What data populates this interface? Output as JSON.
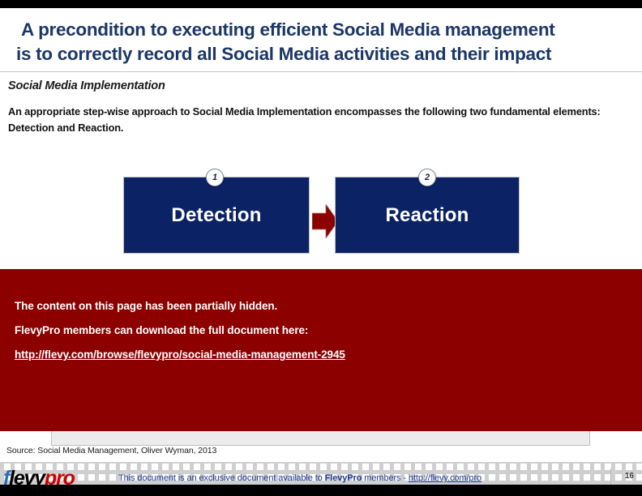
{
  "slide": {
    "title_line_1": "A precondition to executing efficient Social Media management",
    "title_line_2": "is to correctly record all Social Media activities and their impact",
    "subheading": "Social Media Implementation",
    "intro_text": "An appropriate step-wise approach to Social Media Implementation encompasses the following two fundamental elements: Detection and Reaction.",
    "source_note": "Source: Social Media Management, Oliver Wyman, 2013"
  },
  "diagram": {
    "steps": [
      {
        "number": "1",
        "label": "Detection"
      },
      {
        "number": "2",
        "label": "Reaction"
      }
    ],
    "connector": "right-arrow"
  },
  "hidden_notice": {
    "line_1": "The content on this page has been partially hidden.",
    "line_2": "FlevyPro members can download the full document here:",
    "link": "http://flevy.com/browse/flevypro/social-media-management-2945"
  },
  "footer": {
    "logo_part_1": "f",
    "logo_part_2": "levy",
    "logo_part_3": "pro",
    "text_before": "This document is an exclusive document available to ",
    "text_brand": "FlevyPro",
    "text_after": " members - ",
    "text_link": "http://flevy.com/pro",
    "page_number": "16"
  },
  "colors": {
    "title_navy": "#1b3668",
    "box_navy": "#0b2265",
    "arrow_red": "#8c0000",
    "banner_red": "#8c0000",
    "footer_blue": "#1f3a93",
    "logo_blue": "#2a6ebb",
    "logo_red": "#cc0000"
  }
}
